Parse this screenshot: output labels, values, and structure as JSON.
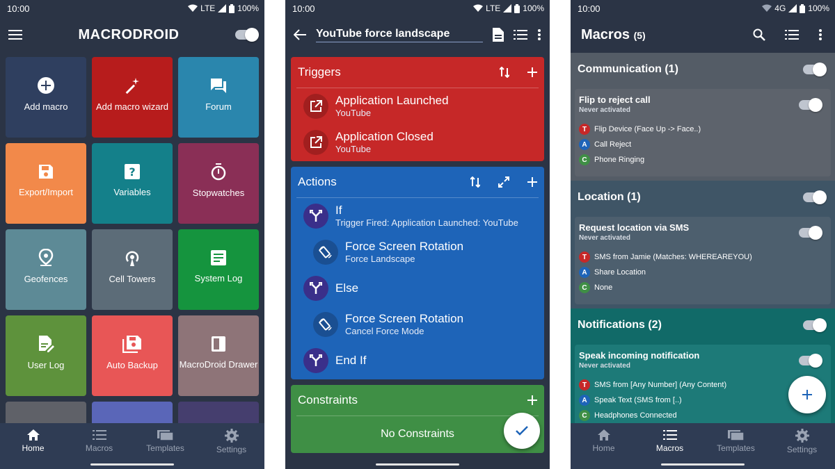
{
  "status": {
    "time": "10:00",
    "network": "LTE",
    "network3": "4G",
    "battery": "100%"
  },
  "home": {
    "title": "MACRODROID",
    "tiles": [
      {
        "label": "Add macro",
        "color": "#2f3f5f"
      },
      {
        "label": "Add macro wizard",
        "color": "#b71c1c"
      },
      {
        "label": "Forum",
        "color": "#2a86ad"
      },
      {
        "label": "Export/Import",
        "color": "#f2894a"
      },
      {
        "label": "Variables",
        "color": "#14808a"
      },
      {
        "label": "Stopwatches",
        "color": "#8a2f56"
      },
      {
        "label": "Geofences",
        "color": "#5d8a96"
      },
      {
        "label": "Cell Towers",
        "color": "#5c6c78"
      },
      {
        "label": "System Log",
        "color": "#15943e"
      },
      {
        "label": "User Log",
        "color": "#5e923c"
      },
      {
        "label": "Auto Backup",
        "color": "#e85656"
      },
      {
        "label": "MacroDroid Drawer",
        "color": "#8e7478"
      }
    ]
  },
  "nav": {
    "home": "Home",
    "macros": "Macros",
    "templates": "Templates",
    "settings": "Settings"
  },
  "editor": {
    "title": "YouTube force landscape",
    "triggers_label": "Triggers",
    "triggers": [
      {
        "title": "Application Launched",
        "subtitle": "YouTube"
      },
      {
        "title": "Application Closed",
        "subtitle": "YouTube"
      }
    ],
    "actions_label": "Actions",
    "actions": [
      {
        "title": "If",
        "subtitle": "Trigger Fired: Application Launched: YouTube"
      },
      {
        "title": "Force Screen Rotation",
        "subtitle": "Force Landscape"
      },
      {
        "title": "Else",
        "subtitle": ""
      },
      {
        "title": "Force Screen Rotation",
        "subtitle": "Cancel Force Mode"
      },
      {
        "title": "End If",
        "subtitle": ""
      }
    ],
    "constraints_label": "Constraints",
    "no_constraints": "No Constraints"
  },
  "macros": {
    "title": "Macros",
    "count": "(5)",
    "categories": [
      {
        "name": "Communication (1)",
        "color": "#545c66"
      },
      {
        "name": "Location (1)",
        "color": "#3f5566"
      },
      {
        "name": "Notifications (2)",
        "color": "#116a68"
      }
    ],
    "cards": [
      {
        "name": "Flip to reject call",
        "status": "Never activated",
        "color": "#5d636c",
        "rows": [
          {
            "type": "T",
            "text": "Flip Device (Face Up -> Face..)"
          },
          {
            "type": "A",
            "text": "Call Reject"
          },
          {
            "type": "C",
            "text": "Phone Ringing"
          }
        ]
      },
      {
        "name": "Request location via SMS",
        "status": "Never activated",
        "color": "#4d5f6e",
        "rows": [
          {
            "type": "T",
            "text": "SMS from Jamie (Matches: WHEREAREYOU)"
          },
          {
            "type": "A",
            "text": "Share Location"
          },
          {
            "type": "C",
            "text": "None"
          }
        ]
      },
      {
        "name": "Speak incoming notification",
        "status": "Never activated",
        "color": "#1d7a78",
        "rows": [
          {
            "type": "T",
            "text": "SMS from [Any Number] (Any Content)"
          },
          {
            "type": "A",
            "text": "Speak Text (SMS from [..)"
          },
          {
            "type": "C",
            "text": "Headphones Connected"
          }
        ]
      }
    ]
  },
  "colors": {
    "trigger": "#c62828",
    "action": "#1e64b8",
    "constraint": "#3f8f45",
    "badge_t": "#c62828",
    "badge_a": "#1e64b8",
    "badge_c": "#3f8f45"
  }
}
